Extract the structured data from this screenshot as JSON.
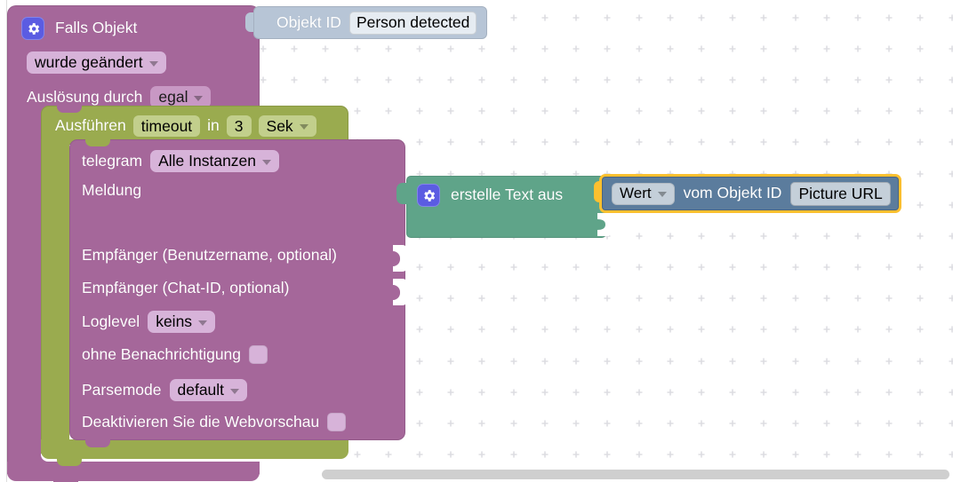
{
  "app": {
    "kind": "blockly-workspace",
    "language": "de"
  },
  "colors": {
    "block_purple": "#a5679a",
    "block_purple_field": "#d7b3d9",
    "block_purple_field_alt": "#c898c4",
    "block_green_control": "#9aab4f",
    "block_green_field": "#c2cf8c",
    "block_teal_text": "#5fa489",
    "block_blue_value": "#5b7c9d",
    "block_blue_field": "#c4cfd9",
    "block_objectid": "#b7c5d6",
    "selection_highlight": "#fdc02f",
    "gear_badge": "#5b5ce2",
    "canvas_background": "#ffffff",
    "grid_dot": "#dddde2",
    "scrollbar_thumb": "#cfcfcf"
  },
  "blocks": {
    "trigger": {
      "name": "falls-objekt-block",
      "gear_icon": "gear-icon",
      "title": "Falls Objekt",
      "change_mode": "wurde geändert",
      "source_label": "Auslösung durch",
      "source_value": "egal",
      "object_id_block": {
        "label": "Objekt ID",
        "value": "Person detected"
      }
    },
    "timeout": {
      "name": "ausfuehren-timeout-block",
      "prefix": "Ausführen",
      "variable": "timeout",
      "in_label": "in",
      "delay": "3",
      "unit": "Sek"
    },
    "telegram": {
      "name": "telegram-sendto-block",
      "title": "telegram",
      "instance": "Alle Instanzen",
      "message_label": "Meldung",
      "recipient_username_label": "Empfänger (Benutzername, optional)",
      "recipient_chatid_label": "Empfänger (Chat-ID, optional)",
      "loglevel_label": "Loglevel",
      "loglevel_value": "keins",
      "silent_label": "ohne Benachrichtigung",
      "silent_checked": false,
      "parsemode_label": "Parsemode",
      "parsemode_value": "default",
      "webpreview_label": "Deaktivieren Sie die Webvorschau",
      "webpreview_checked": false
    },
    "create_text": {
      "name": "erstelle-text-aus-block",
      "gear_icon": "gear-icon",
      "title": "erstelle Text aus"
    },
    "value_selected": {
      "name": "wert-vom-objekt-id-block",
      "selected": true,
      "property": "Wert",
      "middle_label": "vom Objekt ID",
      "object_id": "Picture URL"
    }
  },
  "scrollbar": {
    "name": "horizontal-scrollbar",
    "orientation": "horizontal"
  }
}
